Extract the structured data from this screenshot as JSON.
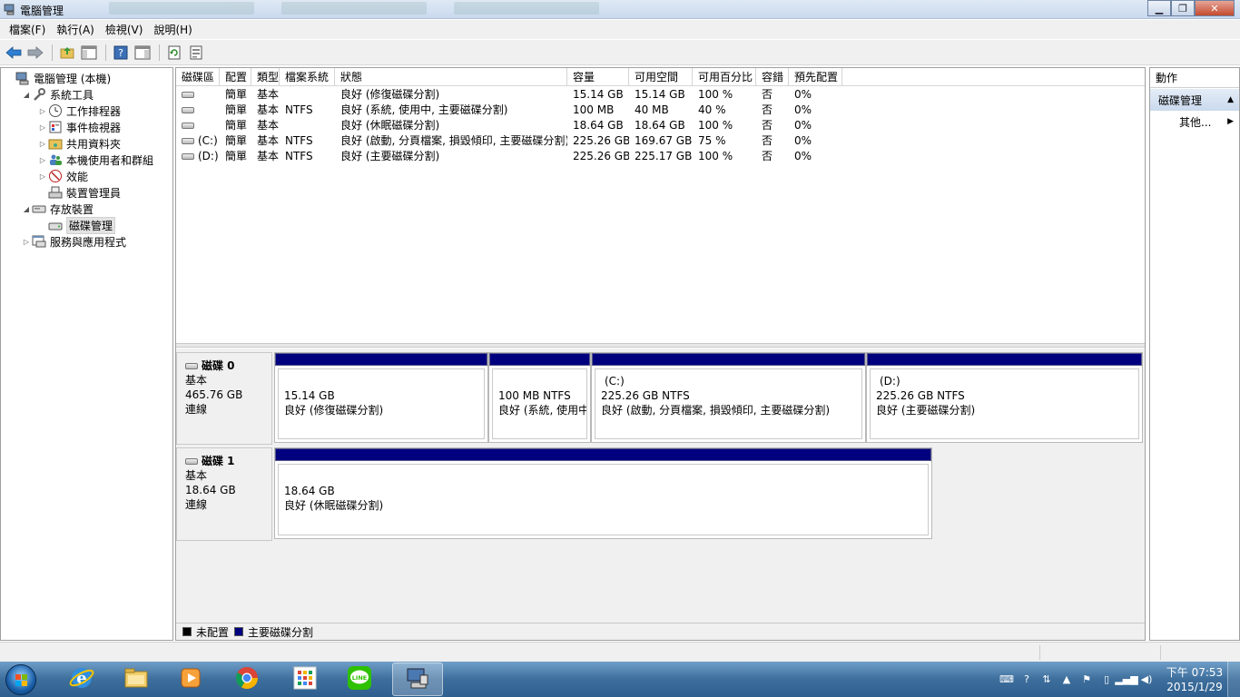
{
  "window": {
    "title": "電腦管理"
  },
  "menu": [
    "檔案(F)",
    "執行(A)",
    "檢視(V)",
    "說明(H)"
  ],
  "tree": [
    {
      "label": "電腦管理 (本機)",
      "indent": 0,
      "expander": "",
      "icon": "computer-management-icon"
    },
    {
      "label": "系統工具",
      "indent": 1,
      "expander": "◢",
      "icon": "tools-icon"
    },
    {
      "label": "工作排程器",
      "indent": 2,
      "expander": "▷",
      "icon": "clock-icon"
    },
    {
      "label": "事件檢視器",
      "indent": 2,
      "expander": "▷",
      "icon": "event-viewer-icon"
    },
    {
      "label": "共用資料夾",
      "indent": 2,
      "expander": "▷",
      "icon": "shared-folder-icon"
    },
    {
      "label": "本機使用者和群組",
      "indent": 2,
      "expander": "▷",
      "icon": "users-icon"
    },
    {
      "label": "效能",
      "indent": 2,
      "expander": "▷",
      "icon": "performance-icon"
    },
    {
      "label": "裝置管理員",
      "indent": 2,
      "expander": "",
      "icon": "device-manager-icon"
    },
    {
      "label": "存放裝置",
      "indent": 1,
      "expander": "◢",
      "icon": "storage-icon"
    },
    {
      "label": "磁碟管理",
      "indent": 2,
      "expander": "",
      "icon": "disk-management-icon",
      "selected": true
    },
    {
      "label": "服務與應用程式",
      "indent": 1,
      "expander": "▷",
      "icon": "services-icon"
    }
  ],
  "volume_table": {
    "headers": [
      "磁碟區",
      "配置",
      "類型",
      "檔案系統",
      "狀態",
      "容量",
      "可用空間",
      "可用百分比",
      "容錯",
      "預先配置"
    ],
    "rows": [
      [
        "",
        "簡單",
        "基本",
        "",
        "良好 (修復磁碟分割)",
        "15.14 GB",
        "15.14 GB",
        "100 %",
        "否",
        "0%"
      ],
      [
        "",
        "簡單",
        "基本",
        "NTFS",
        "良好 (系統, 使用中, 主要磁碟分割)",
        "100 MB",
        "40 MB",
        "40 %",
        "否",
        "0%"
      ],
      [
        "",
        "簡單",
        "基本",
        "",
        "良好 (休眠磁碟分割)",
        "18.64 GB",
        "18.64 GB",
        "100 %",
        "否",
        "0%"
      ],
      [
        "(C:)",
        "簡單",
        "基本",
        "NTFS",
        "良好 (啟動, 分頁檔案, 損毀傾印, 主要磁碟分割)",
        "225.26 GB",
        "169.67 GB",
        "75 %",
        "否",
        "0%"
      ],
      [
        "(D:)",
        "簡單",
        "基本",
        "NTFS",
        "良好 (主要磁碟分割)",
        "225.26 GB",
        "225.17 GB",
        "100 %",
        "否",
        "0%"
      ]
    ]
  },
  "disks": [
    {
      "name": "磁碟 0",
      "type": "基本",
      "size": "465.76 GB",
      "status": "連線",
      "partitions": [
        {
          "label": "",
          "size": "15.14 GB",
          "status": "良好 (修復磁碟分割)"
        },
        {
          "label": "",
          "size": "100 MB NTFS",
          "status": "良好 (系統, 使用中"
        },
        {
          "label": "(C:)",
          "size": "225.26 GB NTFS",
          "status": "良好 (啟動, 分頁檔案, 損毀傾印, 主要磁碟分割)"
        },
        {
          "label": "(D:)",
          "size": "225.26 GB NTFS",
          "status": "良好 (主要磁碟分割)"
        }
      ]
    },
    {
      "name": "磁碟 1",
      "type": "基本",
      "size": "18.64 GB",
      "status": "連線",
      "partitions": [
        {
          "label": "",
          "size": "18.64 GB",
          "status": "良好 (休眠磁碟分割)"
        }
      ]
    }
  ],
  "legend": [
    {
      "label": "未配置",
      "color": "#000000"
    },
    {
      "label": "主要磁碟分割",
      "color": "#00007f"
    }
  ],
  "actions": {
    "header": "動作",
    "section": "磁碟管理",
    "more": "其他..."
  },
  "taskbar": {
    "apps": [
      "ie-icon",
      "file-explorer-icon",
      "media-player-icon",
      "chrome-icon",
      "apps-grid-icon",
      "line-icon",
      "computer-management-icon"
    ],
    "time": "下午 07:53",
    "date": "2015/1/29"
  },
  "colors": {
    "partition_primary": "#00007f",
    "title_bar": "#dfe9f5",
    "taskbar": "#3d6e9c"
  }
}
